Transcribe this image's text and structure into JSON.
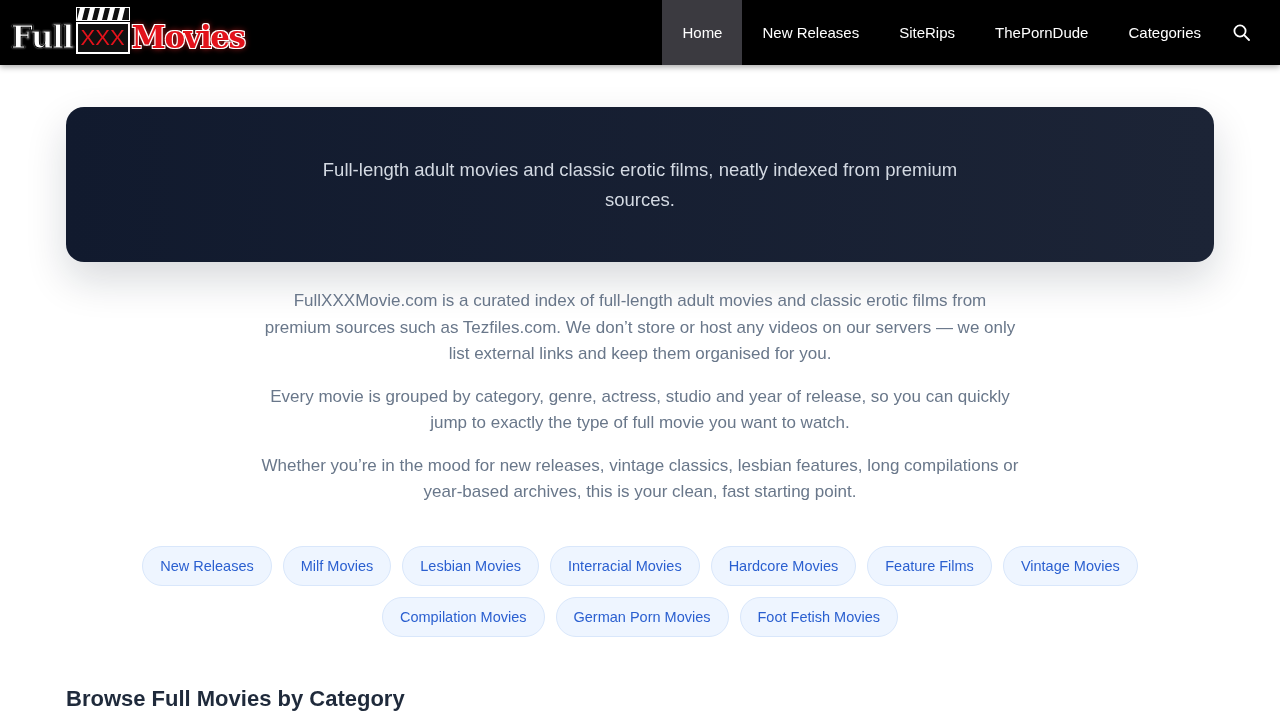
{
  "header": {
    "logo": {
      "word_1": "Full",
      "word_2": "XXX",
      "word_3": "Movies"
    },
    "nav": [
      {
        "label": "Home",
        "selected": true
      },
      {
        "label": "New Releases",
        "selected": false
      },
      {
        "label": "SiteRips",
        "selected": false
      },
      {
        "label": "ThePornDude",
        "selected": false
      },
      {
        "label": "Categories",
        "selected": false
      }
    ]
  },
  "hero": {
    "tagline": "Full-length adult movies and classic erotic films, neatly indexed from premium sources."
  },
  "intro": [
    "FullXXXMovie.com is a curated index of full-length adult movies and classic erotic films from premium sources such as Tezfiles.com. We don’t store or host any videos on our servers — we only list external links and keep them organised for you.",
    "Every movie is grouped by category, genre, actress, studio and year of release, so you can quickly jump to exactly the type of full movie you want to watch.",
    "Whether you’re in the mood for new releases, vintage classics, lesbian features, long compilations or year-based archives, this is your clean, fast starting point."
  ],
  "category_links": [
    "New Releases",
    "Milf Movies",
    "Lesbian Movies",
    "Interracial Movies",
    "Hardcore Movies",
    "Feature Films",
    "Vintage Movies",
    "Compilation Movies",
    "German Porn Movies",
    "Foot Fetish Movies"
  ],
  "section": {
    "heading": "Browse Full Movies by Category"
  }
}
